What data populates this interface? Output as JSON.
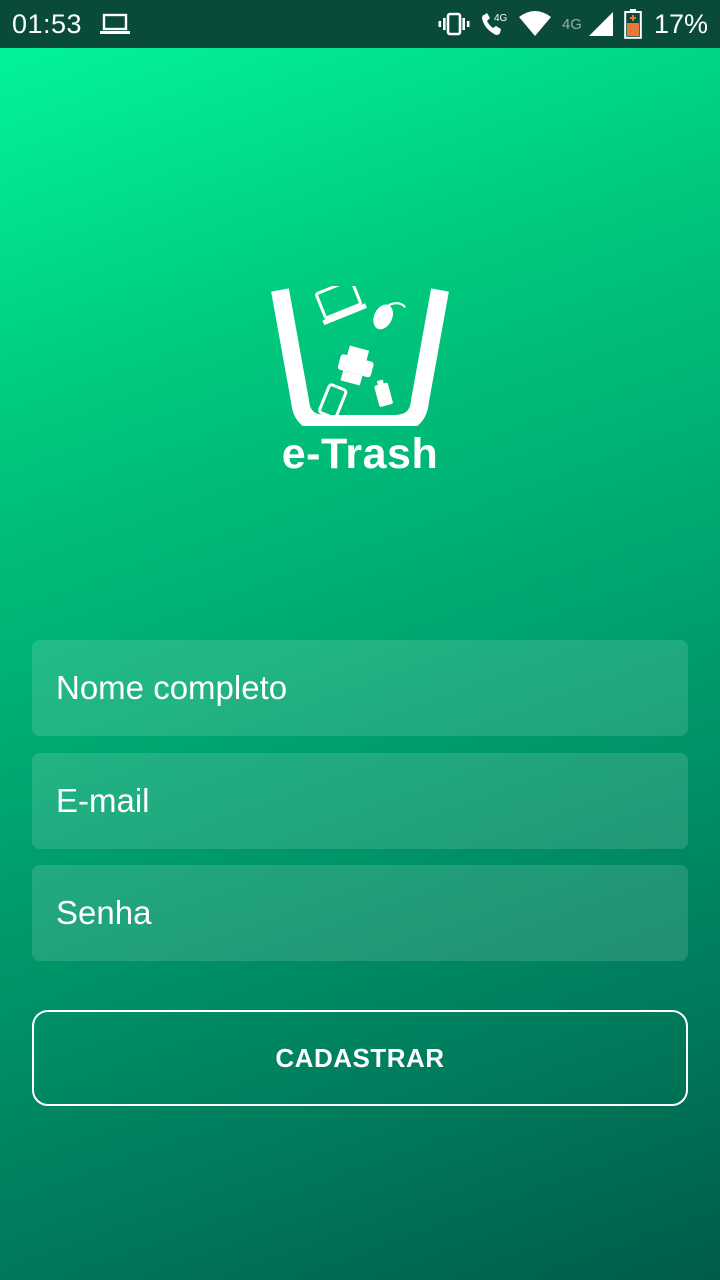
{
  "status_bar": {
    "time": "01:53",
    "net_label": "4G",
    "battery_percent": "17%",
    "icons": [
      "laptop-icon",
      "vibrate-icon",
      "volte-call-icon",
      "wifi-icon",
      "signal-icon",
      "battery-icon"
    ]
  },
  "logo": {
    "text": "e-Trash"
  },
  "form": {
    "name_placeholder": "Nome completo",
    "email_placeholder": "E-mail",
    "password_placeholder": "Senha",
    "submit_label": "CADASTRAR"
  },
  "colors": {
    "gradient_start": "#02f39b",
    "gradient_end": "#005c48",
    "status_bar": "#0a4a3a",
    "text": "#ffffff",
    "battery_fill": "#e8773a"
  }
}
